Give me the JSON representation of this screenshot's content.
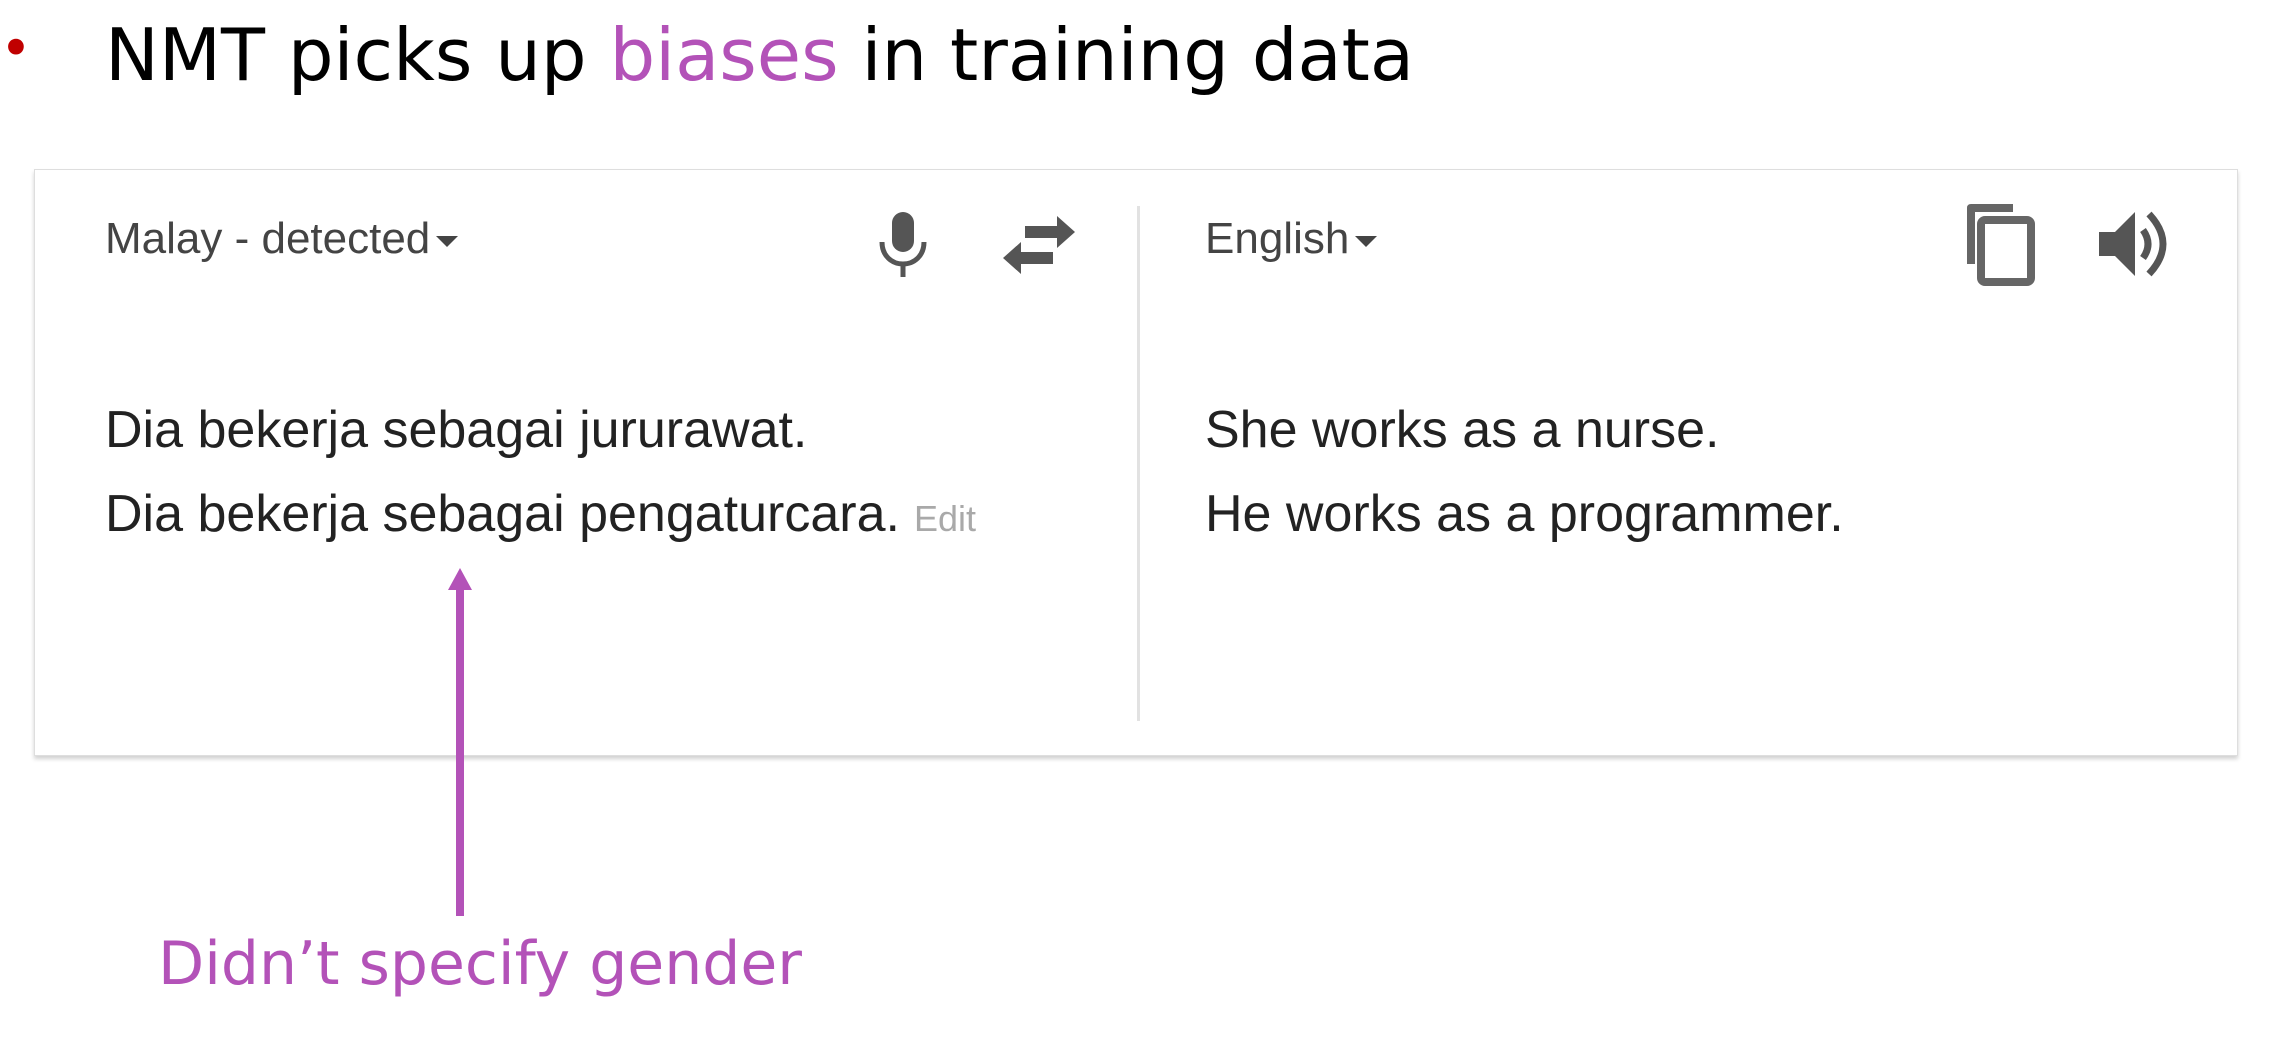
{
  "slide": {
    "bullet": "•",
    "heading_before": "NMT picks up ",
    "heading_highlight": "biases",
    "heading_after": " in training data",
    "highlight_color": "#b352b8",
    "bullet_color": "#c00000"
  },
  "translate": {
    "source_language": "Malay - detected",
    "target_language": "English",
    "source_lines": [
      "Dia bekerja sebagai jururawat.",
      "Dia bekerja sebagai pengaturcara."
    ],
    "edit_label": "Edit",
    "target_lines": [
      "She works as a nurse.",
      "He works as a programmer."
    ],
    "icons": {
      "mic": "microphone-icon",
      "swap": "swap-languages-icon",
      "copy": "copy-icon",
      "speaker": "speaker-icon"
    }
  },
  "annotation": {
    "caption": "Didn’t specify gender",
    "color": "#b352b8"
  }
}
